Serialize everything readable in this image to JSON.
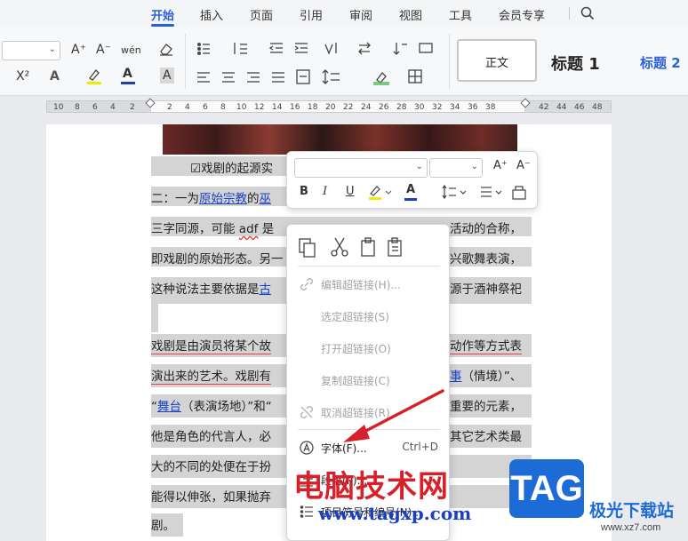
{
  "menu": {
    "tabs": [
      "开始",
      "插入",
      "页面",
      "引用",
      "审阅",
      "视图",
      "工具",
      "会员专享"
    ],
    "active_tab": "开始"
  },
  "toolbar": {
    "font_size_value": "",
    "grow_font": "A⁺",
    "shrink_font": "A⁻",
    "phonetic": "wén",
    "superscript": "X²",
    "font_color": "A",
    "char_shading": "A"
  },
  "styles": {
    "normal": "正文",
    "heading1": "标题 1",
    "heading2": "标题 2"
  },
  "ruler": {
    "left_numbers": [
      "10",
      "8",
      "6",
      "4",
      "2"
    ],
    "right_numbers": [
      "2",
      "4",
      "6",
      "8",
      "10",
      "12",
      "14",
      "16",
      "18",
      "20",
      "22",
      "24",
      "26",
      "28",
      "30",
      "32",
      "34",
      "36",
      "38"
    ],
    "far_right_numbers": [
      "42",
      "44",
      "46",
      "48"
    ]
  },
  "document": {
    "line1": "☑戏剧的起源实",
    "line2_prefix": "二：一为",
    "line2_link1": "原始宗教",
    "line2_mid": "的",
    "line2_link2": "巫",
    "line3a": "三字同源，可能 ",
    "line3_wavy": "adf",
    "line3b": " 是",
    "line3_right": "活动的合称，",
    "line4a": "即戏剧的原始形态。另一",
    "line4_right": "兴歌舞表演，",
    "line5a": "这种说法主要依据是",
    "line5_link": "古",
    "line5_right": "源于酒神祭祀",
    "line6a": "戏剧是由演员将某个故",
    "line6_right": "动作等方式表",
    "line7a": "演出来的艺术。戏剧有",
    "line7_link": "事",
    "line7_right": "（情境）”、",
    "line8_open": "“",
    "line8_link": "舞台",
    "line8_mid": "（表演场地）”和“",
    "line8_right": "重要的元素，",
    "line9a": "他是角色的代言人，必",
    "line9_right": "其它艺术类最",
    "line10a": "大的不同的处便在于扮",
    "line11a": "能得以伸张，如果抛弃",
    "line12a": "剧。"
  },
  "mini_toolbar": {
    "font_name_value": "",
    "font_size_value": "",
    "bold": "B",
    "italic": "I",
    "underline": "U",
    "font_color": "A"
  },
  "context_menu": {
    "items": [
      {
        "label": "编辑超链接(H)...",
        "icon": "link-edit-icon",
        "disabled": true
      },
      {
        "label": "选定超链接(S)",
        "icon": "",
        "disabled": true
      },
      {
        "label": "打开超链接(O)",
        "icon": "",
        "disabled": true
      },
      {
        "label": "复制超链接(C)",
        "icon": "",
        "disabled": true
      },
      {
        "label": "取消超链接(R)",
        "icon": "unlink-icon",
        "disabled": true
      },
      {
        "label": "字体(F)...",
        "icon": "font-icon",
        "disabled": false,
        "shortcut": "Ctrl+D"
      },
      {
        "label": "段落(P)...",
        "icon": "paragraph-icon",
        "disabled": false
      },
      {
        "label": "项目符号和编号(N)...",
        "icon": "bullets-icon",
        "disabled": false
      }
    ]
  },
  "watermark": {
    "site_name": "电脑技术网",
    "site_url": "www.tagxp.com",
    "logo": "TAG",
    "logo_text": "极光下载站",
    "logo_url": "www.xz7.com"
  },
  "colors": {
    "accent": "#2b5fd9",
    "highlight": "#d4d4d4",
    "link": "#1a3fc2",
    "arrow": "#d8202a"
  }
}
